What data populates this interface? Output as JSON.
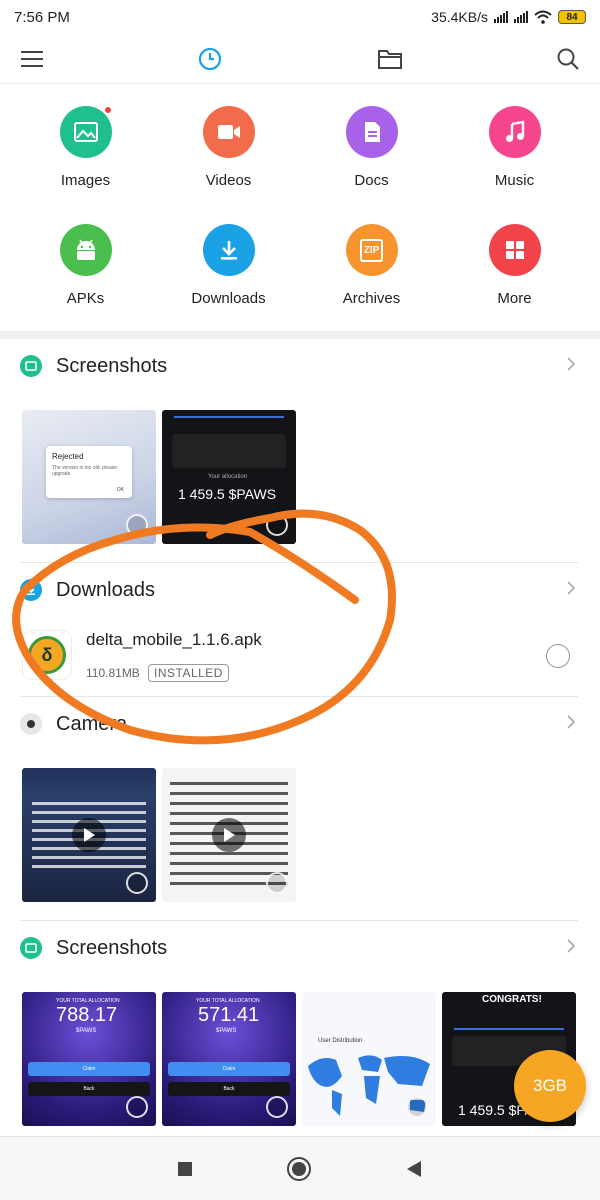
{
  "status_bar": {
    "time": "7:56 PM",
    "network_speed": "35.4KB/s",
    "battery": "84"
  },
  "toolbar": {
    "menu_icon": "menu-icon",
    "recent_icon": "clock-icon",
    "folder_icon": "folder-icon",
    "search_icon": "search-icon",
    "accent": "#1aa1e6"
  },
  "categories": [
    {
      "label": "Images",
      "icon": "image-icon",
      "color": "#1fbf8f",
      "badge": true
    },
    {
      "label": "Videos",
      "icon": "video-icon",
      "color": "#f26b4a"
    },
    {
      "label": "Docs",
      "icon": "doc-icon",
      "color": "#a862ea"
    },
    {
      "label": "Music",
      "icon": "music-icon",
      "color": "#f5458c"
    },
    {
      "label": "APKs",
      "icon": "android-icon",
      "color": "#4bbf4e"
    },
    {
      "label": "Downloads",
      "icon": "download-icon",
      "color": "#1aa1e6"
    },
    {
      "label": "Archives",
      "icon": "zip-icon",
      "color": "#f7942e",
      "icon_text": "ZIP"
    },
    {
      "label": "More",
      "icon": "grid-icon",
      "color": "#f2434a"
    }
  ],
  "sections": {
    "screenshots_1": {
      "title": "Screenshots",
      "thumb_texts": {
        "rejected_title": "Rejected",
        "rejected_body": "The version is too old, please upgrade",
        "ok": "OK",
        "paws_amount": "1 459.5 $PAWS",
        "your_allocation": "Your allocation"
      }
    },
    "downloads": {
      "title": "Downloads",
      "file_name": "delta_mobile_1.1.6.apk",
      "file_size": "110.81MB",
      "status": "INSTALLED",
      "app_icon_letter": "δ"
    },
    "camera": {
      "title": "Camera"
    },
    "screenshots_2": {
      "title": "Screenshots",
      "thumb_texts": {
        "allocation_label": "YOUR TOTAL ALLOCATION",
        "value_1": "788.17",
        "value_2": "571.41",
        "unit": "$PAWS",
        "claim": "Claim",
        "back": "Back",
        "user_distribution": "User Distribution",
        "congrats": "CONGRATS!",
        "paws_amount": "1 459.5 $PAWS"
      }
    }
  },
  "fab": {
    "label": "3GB",
    "color": "#f5a623"
  },
  "annotation_color": "#f07a22"
}
